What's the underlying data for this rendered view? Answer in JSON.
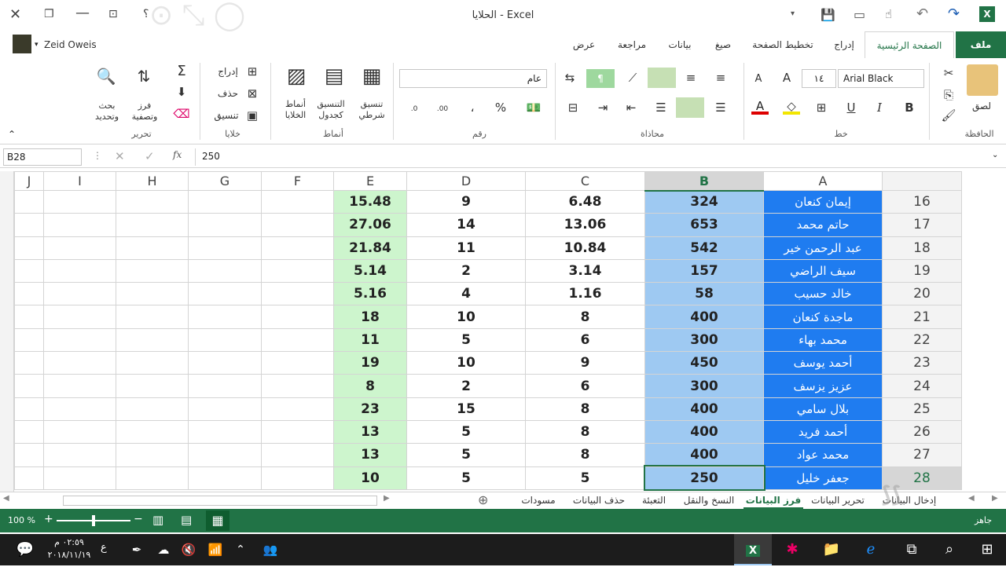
{
  "window": {
    "title": "الحلايا - Excel",
    "user": "Zeid Oweis",
    "help": "؟",
    "qat": [
      "save",
      "new",
      "touch",
      "undo",
      "redo"
    ]
  },
  "tabs": [
    "ملف",
    "الصفحة الرئيسية",
    "إدراج",
    "تخطيط الصفحة",
    "صيغ",
    "بيانات",
    "مراجعة",
    "عرض"
  ],
  "ribbon": {
    "groups": [
      "الحافظة",
      "خط",
      "محاذاة",
      "رقم",
      "أنماط",
      "خلايا",
      "تحرير"
    ],
    "paste": "لصق",
    "font_name": "Arial Black",
    "font_size": "١٤",
    "number_format": "عام",
    "styles": {
      "conditional": "تنسيق شرطي",
      "as_table": "التنسيق كجدول",
      "cell_styles": "أنماط الخلايا"
    },
    "cells": {
      "insert": "إدراج",
      "delete": "حذف",
      "format": "تنسيق"
    },
    "editing": {
      "sort": "فرز وتصفية",
      "find": "بحث وتحديد"
    },
    "format_buttons": {
      "bold": "B",
      "italic": "I",
      "underline": "U",
      "percent": "%",
      "comma": "،"
    }
  },
  "formula_bar": {
    "name_box": "B28",
    "formula": "250",
    "fx": "fx"
  },
  "columns": [
    "A",
    "B",
    "C",
    "D",
    "E",
    "F",
    "G",
    "H",
    "I",
    "J"
  ],
  "rows": [
    {
      "n": "16",
      "a": "إيمان كنعان",
      "b": "324",
      "c": "6.48",
      "d": "9",
      "e": "15.48"
    },
    {
      "n": "17",
      "a": "حاتم محمد",
      "b": "653",
      "c": "13.06",
      "d": "14",
      "e": "27.06"
    },
    {
      "n": "18",
      "a": "عبد الرحمن خير",
      "b": "542",
      "c": "10.84",
      "d": "11",
      "e": "21.84"
    },
    {
      "n": "19",
      "a": "سيف الراضي",
      "b": "157",
      "c": "3.14",
      "d": "2",
      "e": "5.14"
    },
    {
      "n": "20",
      "a": "خالد حسيب",
      "b": "58",
      "c": "1.16",
      "d": "4",
      "e": "5.16"
    },
    {
      "n": "21",
      "a": "ماجدة كنعان",
      "b": "400",
      "c": "8",
      "d": "10",
      "e": "18"
    },
    {
      "n": "22",
      "a": "محمد بهاء",
      "b": "300",
      "c": "6",
      "d": "5",
      "e": "11"
    },
    {
      "n": "23",
      "a": "أحمد يوسف",
      "b": "450",
      "c": "9",
      "d": "10",
      "e": "19"
    },
    {
      "n": "24",
      "a": "عزيز يزسف",
      "b": "300",
      "c": "6",
      "d": "2",
      "e": "8"
    },
    {
      "n": "25",
      "a": "بلال سامي",
      "b": "400",
      "c": "8",
      "d": "15",
      "e": "23"
    },
    {
      "n": "26",
      "a": "أحمد فريد",
      "b": "400",
      "c": "8",
      "d": "5",
      "e": "13"
    },
    {
      "n": "27",
      "a": "محمد عواد",
      "b": "400",
      "c": "8",
      "d": "5",
      "e": "13"
    },
    {
      "n": "28",
      "a": "جعفر خليل",
      "b": "250",
      "c": "5",
      "d": "5",
      "e": "10"
    }
  ],
  "sheets": [
    "إدخال البيانات",
    "تحرير البيانات",
    "فرز البيانات",
    "النسخ والنقل",
    "التعبئة",
    "حذف البيانات",
    "مسودات"
  ],
  "active_sheet": "فرز البيانات",
  "status": {
    "ready": "جاهز",
    "zoom": "100 %"
  },
  "taskbar": {
    "time": "٠٢:٥٩ م",
    "date": "٢٠١٨/١١/١٩",
    "lang": "ع"
  },
  "colors": {
    "excel_green": "#217346",
    "name_col": "#1f7cf0",
    "b_col": "#9ec9f2",
    "e_col": "#cdf5cd"
  }
}
